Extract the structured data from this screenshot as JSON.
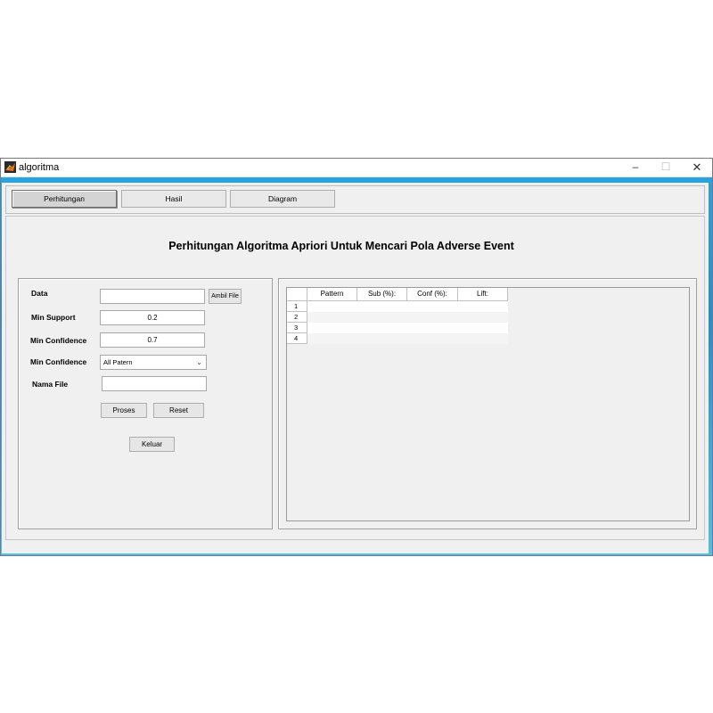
{
  "window": {
    "title": "algoritma",
    "controls": {
      "minimize": "–",
      "maximize": "☐",
      "close": "✕"
    }
  },
  "tabs": [
    {
      "label": "Perhitungan",
      "active": true
    },
    {
      "label": "Hasil",
      "active": false
    },
    {
      "label": "Diagram",
      "active": false
    }
  ],
  "heading": "Perhitungan Algoritma Apriori Untuk Mencari Pola Adverse Event",
  "form": {
    "data_label": "Data",
    "data_value": "",
    "ambil_file_button": "Ambil File",
    "min_support_label": "Min Support",
    "min_support_value": "0.2",
    "min_confidence_label": "Min Confidence",
    "min_confidence_value": "0.7",
    "pattern_select_label": "Min Confidence",
    "pattern_select_value": "All Patern",
    "nama_file_label": "Nama File",
    "nama_file_value": "",
    "proses_button": "Proses",
    "reset_button": "Reset",
    "keluar_button": "Keluar"
  },
  "table": {
    "columns": [
      "Pattern",
      "Sub (%):",
      "Conf (%):",
      "Lift:"
    ],
    "row_numbers": [
      "1",
      "2",
      "3",
      "4"
    ]
  },
  "colors": {
    "desktop": "#1e8fd9",
    "panel": "#f0f0f0"
  }
}
